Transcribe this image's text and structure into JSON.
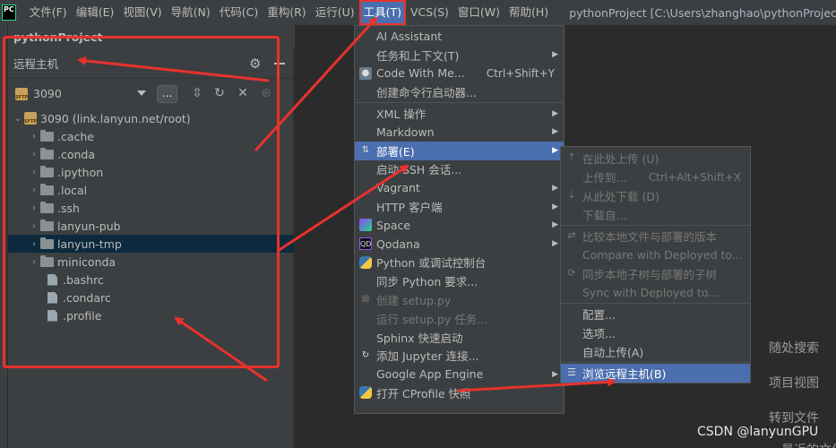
{
  "menubar": {
    "logo": "PC",
    "items": [
      "文件(F)",
      "编辑(E)",
      "视图(V)",
      "导航(N)",
      "代码(C)",
      "重构(R)",
      "运行(U)",
      "工具(T)",
      "VCS(S)",
      "窗口(W)",
      "帮助(H)"
    ],
    "window_title": "pythonProject [C:\\Users\\zhanghao\\pythonProject]"
  },
  "project": {
    "title": "pythonProject"
  },
  "remote": {
    "title": "远程主机",
    "server": "3090",
    "dots": "...",
    "root": "3090 (link.lanyun.net/root)",
    "folders": [
      ".cache",
      ".conda",
      ".ipython",
      ".local",
      ".ssh",
      "lanyun-pub",
      "lanyun-tmp",
      "miniconda"
    ],
    "files": [
      ".bashrc",
      ".condarc",
      ".profile"
    ]
  },
  "tools_menu": {
    "items": [
      {
        "label": "AI Assistant"
      },
      {
        "label": "任务和上下文(T)"
      },
      {
        "label": "Code With Me...",
        "shortcut": "Ctrl+Shift+Y"
      },
      {
        "label": "创建命令行启动器..."
      },
      {
        "label": "XML 操作"
      },
      {
        "label": "Markdown"
      },
      {
        "label": "部署(E)"
      },
      {
        "label": "启动 SSH 会话..."
      },
      {
        "label": "Vagrant"
      },
      {
        "label": "HTTP 客户端"
      },
      {
        "label": "Space"
      },
      {
        "label": "Qodana"
      },
      {
        "label": "Python 或调试控制台"
      },
      {
        "label": "同步 Python 要求..."
      },
      {
        "label": "创建 setup.py"
      },
      {
        "label": "运行 setup.py 任务..."
      },
      {
        "label": "Sphinx 快速启动"
      },
      {
        "label": "添加 Jupyter 连接..."
      },
      {
        "label": "Google App Engine"
      },
      {
        "label": "打开 CProfile 快照"
      }
    ]
  },
  "deploy_menu": {
    "items": [
      {
        "label": "在此处上传 (U)"
      },
      {
        "label": "上传到...",
        "shortcut": "Ctrl+Alt+Shift+X"
      },
      {
        "label": "从此处下载 (D)"
      },
      {
        "label": "下载自..."
      },
      {
        "label": "比较本地文件与部署的版本"
      },
      {
        "label": "Compare with Deployed to..."
      },
      {
        "label": "同步本地子树与部署的子树"
      },
      {
        "label": "Sync with Deployed to..."
      },
      {
        "label": "配置..."
      },
      {
        "label": "选项..."
      },
      {
        "label": "自动上传(A)"
      },
      {
        "label": "浏览远程主机(B)"
      }
    ]
  },
  "editor_hints": [
    "随处搜索",
    "项目视图",
    "转到文件"
  ],
  "partial_hint": "最近的文件",
  "watermark": "CSDN @lanyunGPU",
  "colors": {
    "accent": "#4b6eaf",
    "annotation": "#e8322d",
    "selected_row": "#0d293e"
  }
}
